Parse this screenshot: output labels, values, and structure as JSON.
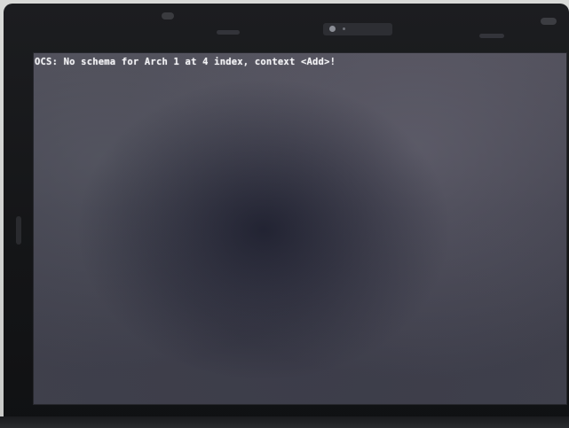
{
  "screen": {
    "console_line": "OCS: No schema for Arch 1 at 4 index, context <Add>!"
  },
  "colors": {
    "bezel": "#141517",
    "screen_background": "#44444f",
    "console_text": "#f1f1f4"
  },
  "icons": {
    "webcam": "webcam-icon"
  }
}
